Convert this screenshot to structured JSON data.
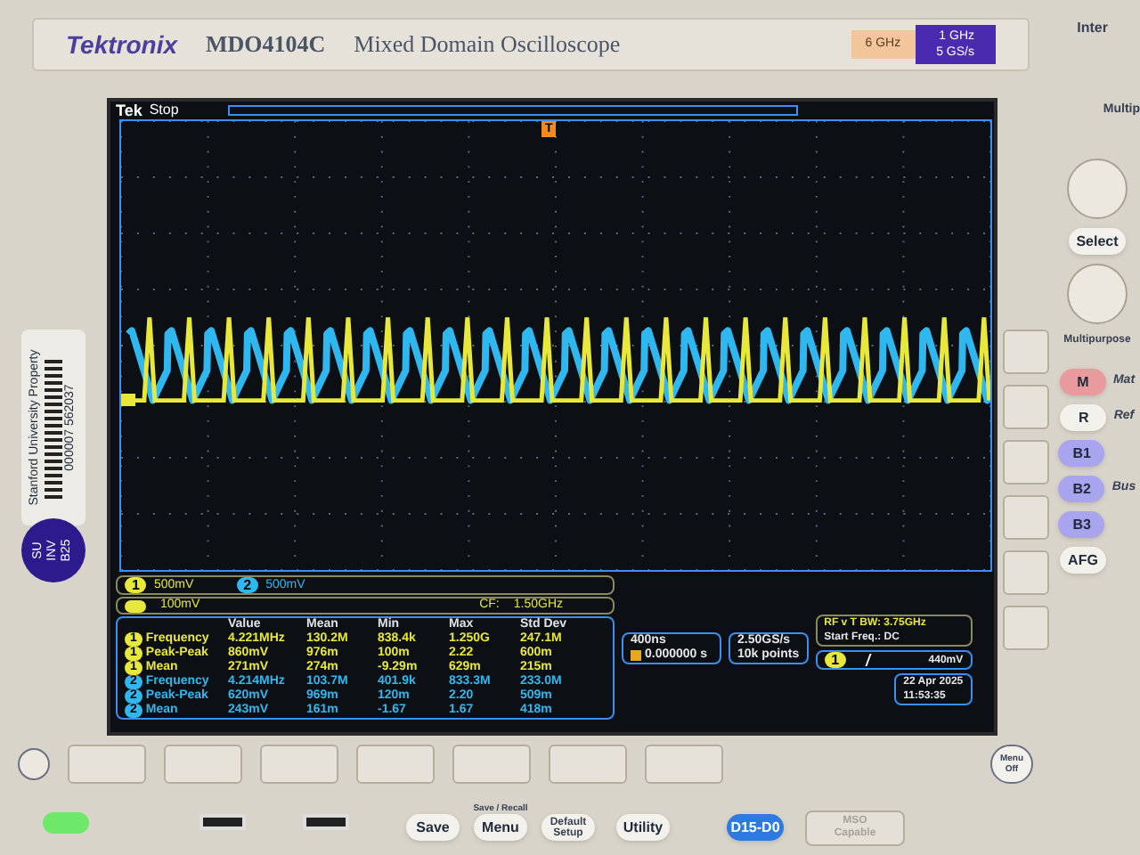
{
  "header": {
    "brand": "Tektronix",
    "model": "MDO4104C",
    "product": "Mixed Domain Oscilloscope",
    "badge_rf": "6 GHz",
    "badge_bw": "1 GHz",
    "badge_rate": "5 GS/s"
  },
  "front_labels": {
    "top_right": "Inter",
    "top_right_2": "Multip"
  },
  "sticker": {
    "owner": "Stanford University Property",
    "number": "000007 562037",
    "inventory": [
      "SU",
      "INV",
      "B25"
    ]
  },
  "screen": {
    "brand": "Tek",
    "state": "Stop",
    "trigger_marker": "T",
    "channels": [
      {
        "channel": "1",
        "scale": "500mV",
        "color": "#e8e83a"
      },
      {
        "channel": "2",
        "scale": "500mV",
        "color": "#2fb8f0"
      }
    ],
    "rf": {
      "scale": "100mV",
      "center": "CF:",
      "center_value": "1.50GHz"
    },
    "measure_columns": [
      "Value",
      "Mean",
      "Min",
      "Max",
      "Std Dev"
    ],
    "measurements": [
      {
        "channel": "1",
        "color": "#e8e83a",
        "name": "Frequency",
        "values": [
          "4.221MHz",
          "130.2M",
          "838.4k",
          "1.250G",
          "247.1M"
        ]
      },
      {
        "channel": "1",
        "color": "#e8e83a",
        "name": "Peak-Peak",
        "values": [
          "860mV",
          "976m",
          "100m",
          "2.22",
          "600m"
        ]
      },
      {
        "channel": "1",
        "color": "#e8e83a",
        "name": "Mean",
        "values": [
          "271mV",
          "274m",
          "-9.29m",
          "629m",
          "215m"
        ]
      },
      {
        "channel": "2",
        "color": "#2fb8f0",
        "name": "Frequency",
        "values": [
          "4.214MHz",
          "103.7M",
          "401.9k",
          "833.3M",
          "233.0M"
        ]
      },
      {
        "channel": "2",
        "color": "#2fb8f0",
        "name": "Peak-Peak",
        "values": [
          "620mV",
          "969m",
          "120m",
          "2.20",
          "509m"
        ]
      },
      {
        "channel": "2",
        "color": "#2fb8f0",
        "name": "Mean",
        "values": [
          "243mV",
          "161m",
          "-1.67",
          "1.67",
          "418m"
        ]
      }
    ],
    "timebase": {
      "scale": "400ns",
      "position": "0.000000 s"
    },
    "acquisition": {
      "rate": "2.50GS/s",
      "length": "10k points"
    },
    "rf_time": {
      "bandwidth": "RF v T BW: 3.75GHz",
      "start": "Start Freq.: DC"
    },
    "trigger": {
      "channel": "1",
      "level": "440mV"
    },
    "date": "22 Apr 2025",
    "time": "11:53:35"
  },
  "right_controls": {
    "select": "Select",
    "multipurpose": "Multipurpose",
    "math_key": "M",
    "math_label": "Mat",
    "ref_key": "R",
    "ref_label": "Ref",
    "bus_keys": [
      "B1",
      "B2",
      "B3"
    ],
    "bus_label": "Bus",
    "afg": "AFG",
    "menu_off": [
      "Menu",
      "Off"
    ]
  },
  "bottom_controls": {
    "group_label": "Save / Recall",
    "save": "Save",
    "menu": "Menu",
    "default": [
      "Default",
      "Setup"
    ],
    "utility": "Utility",
    "digital": "D15-D0",
    "mso": [
      "MSO",
      "Capable"
    ]
  }
}
